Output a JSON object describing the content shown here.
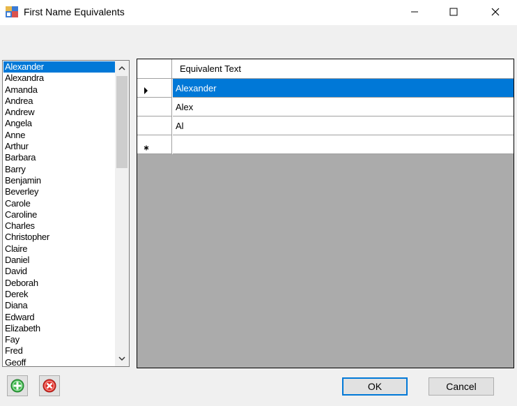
{
  "window": {
    "title": "First Name Equivalents"
  },
  "names_list": {
    "selected": "Alexander",
    "items": [
      "Alexander",
      "Alexandra",
      "Amanda",
      "Andrea",
      "Andrew",
      "Angela",
      "Anne",
      "Arthur",
      "Barbara",
      "Barry",
      "Benjamin",
      "Beverley",
      "Carole",
      "Caroline",
      "Charles",
      "Christopher",
      "Claire",
      "Daniel",
      "David",
      "Deborah",
      "Derek",
      "Diana",
      "Edward",
      "Elizabeth",
      "Fay",
      "Fred",
      "Geoff"
    ]
  },
  "grid": {
    "column_header": "Equivalent Text",
    "rows": [
      {
        "value": "Alexander",
        "selected": true,
        "marker": "current"
      },
      {
        "value": "Alex",
        "selected": false,
        "marker": ""
      },
      {
        "value": "Al",
        "selected": false,
        "marker": ""
      },
      {
        "value": "",
        "selected": false,
        "marker": "new"
      }
    ]
  },
  "buttons": {
    "ok_label": "OK",
    "cancel_label": "Cancel"
  },
  "colors": {
    "selection": "#0078d7",
    "grid_background": "#ababab",
    "add_icon": "#3cb34a",
    "delete_icon": "#e0302a"
  },
  "icons": {
    "app": "app-window-icon",
    "add": "plus-circle-icon",
    "delete": "x-circle-icon"
  }
}
